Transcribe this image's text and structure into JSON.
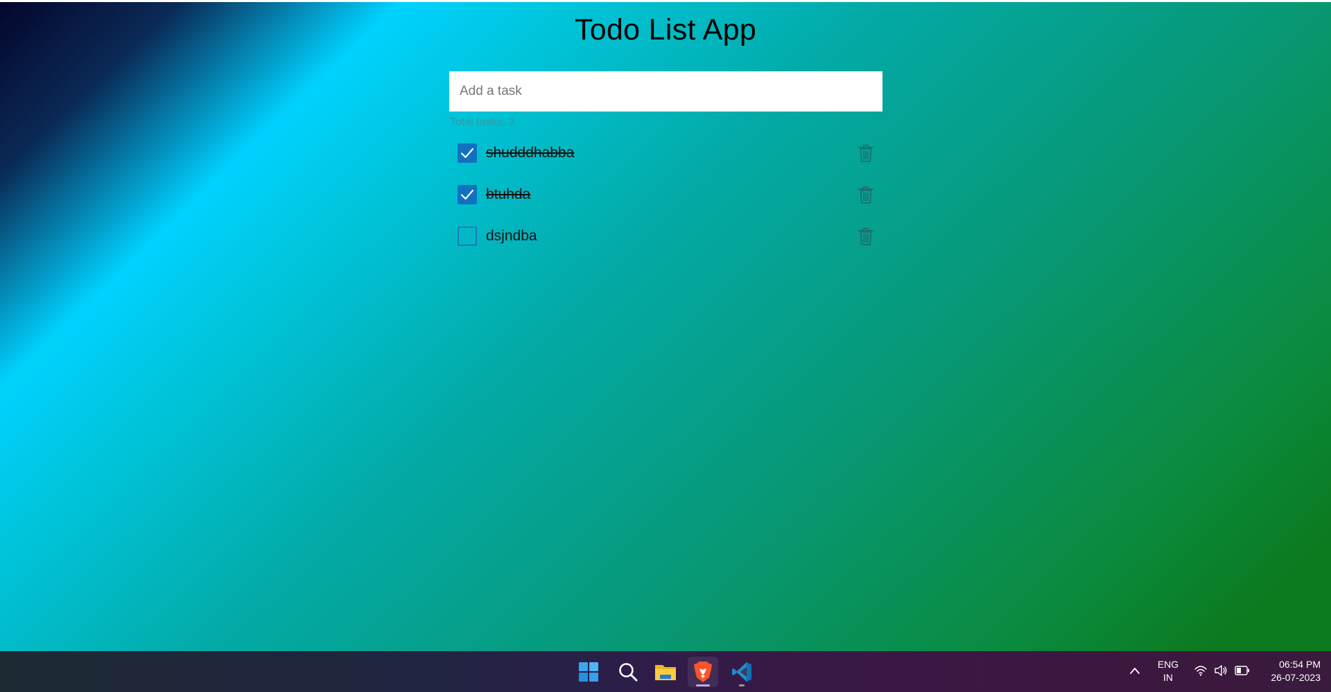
{
  "app": {
    "title": "Todo List App",
    "input_placeholder": "Add a task",
    "total_label": "Total tasks: 3",
    "tasks": [
      {
        "text": "shudddhabba",
        "done": true
      },
      {
        "text": "btuhda",
        "done": true
      },
      {
        "text": "dsjndba",
        "done": false
      }
    ]
  },
  "taskbar": {
    "apps": [
      {
        "name": "start-icon"
      },
      {
        "name": "search-icon"
      },
      {
        "name": "file-explorer-icon"
      },
      {
        "name": "brave-browser-icon"
      },
      {
        "name": "vscode-icon"
      }
    ],
    "language_line1": "ENG",
    "language_line2": "IN",
    "time": "06:54 PM",
    "date": "26-07-2023"
  },
  "colors": {
    "checkbox_checked": "#1071c1",
    "trash_icon": "#1c6f70",
    "total_text": "#2f9a9f"
  }
}
